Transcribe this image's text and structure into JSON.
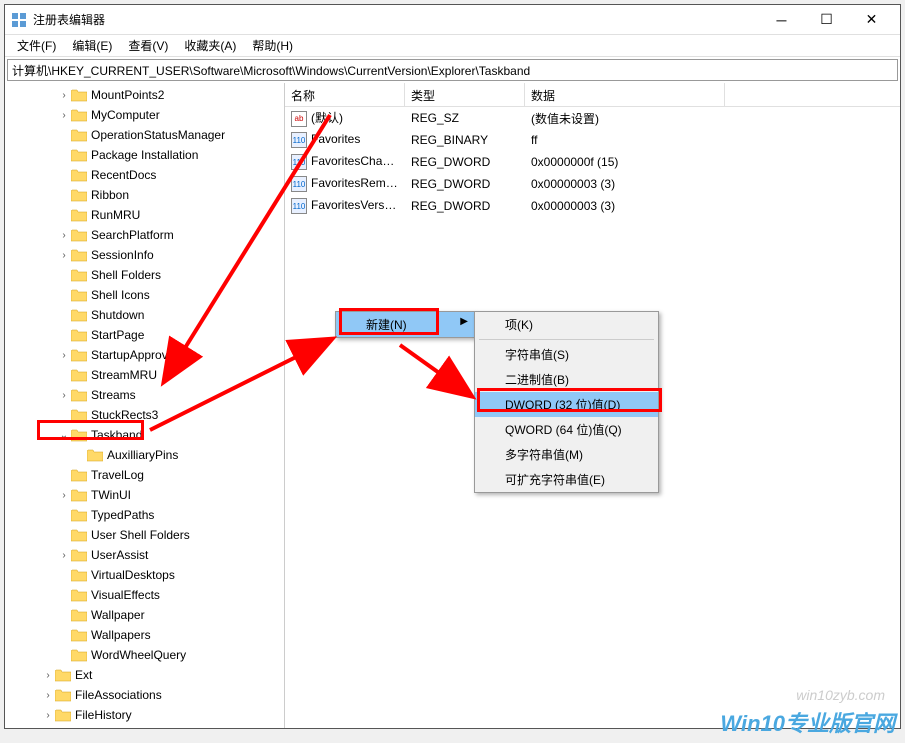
{
  "window": {
    "title": "注册表编辑器"
  },
  "menubar": {
    "file": "文件(F)",
    "edit": "编辑(E)",
    "view": "查看(V)",
    "favorites": "收藏夹(A)",
    "help": "帮助(H)"
  },
  "addressbar": "计算机\\HKEY_CURRENT_USER\\Software\\Microsoft\\Windows\\CurrentVersion\\Explorer\\Taskband",
  "tree": [
    {
      "indent": 3,
      "chev": ">",
      "label": "MountPoints2"
    },
    {
      "indent": 3,
      "chev": ">",
      "label": "MyComputer"
    },
    {
      "indent": 3,
      "chev": "",
      "label": "OperationStatusManager"
    },
    {
      "indent": 3,
      "chev": "",
      "label": "Package Installation"
    },
    {
      "indent": 3,
      "chev": "",
      "label": "RecentDocs"
    },
    {
      "indent": 3,
      "chev": "",
      "label": "Ribbon"
    },
    {
      "indent": 3,
      "chev": "",
      "label": "RunMRU"
    },
    {
      "indent": 3,
      "chev": ">",
      "label": "SearchPlatform"
    },
    {
      "indent": 3,
      "chev": ">",
      "label": "SessionInfo"
    },
    {
      "indent": 3,
      "chev": "",
      "label": "Shell Folders"
    },
    {
      "indent": 3,
      "chev": "",
      "label": "Shell Icons"
    },
    {
      "indent": 3,
      "chev": "",
      "label": "Shutdown"
    },
    {
      "indent": 3,
      "chev": "",
      "label": "StartPage"
    },
    {
      "indent": 3,
      "chev": ">",
      "label": "StartupApproved"
    },
    {
      "indent": 3,
      "chev": "",
      "label": "StreamMRU"
    },
    {
      "indent": 3,
      "chev": ">",
      "label": "Streams"
    },
    {
      "indent": 3,
      "chev": "",
      "label": "StuckRects3"
    },
    {
      "indent": 3,
      "chev": "v",
      "label": "Taskband",
      "highlight": true
    },
    {
      "indent": 4,
      "chev": "",
      "label": "AuxilliaryPins"
    },
    {
      "indent": 3,
      "chev": "",
      "label": "TravelLog"
    },
    {
      "indent": 3,
      "chev": ">",
      "label": "TWinUI"
    },
    {
      "indent": 3,
      "chev": "",
      "label": "TypedPaths"
    },
    {
      "indent": 3,
      "chev": "",
      "label": "User Shell Folders"
    },
    {
      "indent": 3,
      "chev": ">",
      "label": "UserAssist"
    },
    {
      "indent": 3,
      "chev": "",
      "label": "VirtualDesktops"
    },
    {
      "indent": 3,
      "chev": "",
      "label": "VisualEffects"
    },
    {
      "indent": 3,
      "chev": "",
      "label": "Wallpaper"
    },
    {
      "indent": 3,
      "chev": "",
      "label": "Wallpapers"
    },
    {
      "indent": 3,
      "chev": "",
      "label": "WordWheelQuery"
    },
    {
      "indent": 2,
      "chev": ">",
      "label": "Ext"
    },
    {
      "indent": 2,
      "chev": ">",
      "label": "FileAssociations"
    },
    {
      "indent": 2,
      "chev": ">",
      "label": "FileHistory"
    }
  ],
  "list_header": {
    "name": "名称",
    "type": "类型",
    "data": "数据"
  },
  "list_rows": [
    {
      "icon": "str",
      "name": "(默认)",
      "type": "REG_SZ",
      "data": "(数值未设置)"
    },
    {
      "icon": "bin",
      "name": "Favorites",
      "type": "REG_BINARY",
      "data": "ff"
    },
    {
      "icon": "bin",
      "name": "FavoritesChan...",
      "type": "REG_DWORD",
      "data": "0x0000000f (15)"
    },
    {
      "icon": "bin",
      "name": "FavoritesRemo...",
      "type": "REG_DWORD",
      "data": "0x00000003 (3)"
    },
    {
      "icon": "bin",
      "name": "FavoritesVersion",
      "type": "REG_DWORD",
      "data": "0x00000003 (3)"
    }
  ],
  "context_primary": {
    "new": "新建(N)"
  },
  "context_sub": {
    "key": "项(K)",
    "string": "字符串值(S)",
    "binary": "二进制值(B)",
    "dword": "DWORD (32 位)值(D)",
    "qword": "QWORD (64 位)值(Q)",
    "multi": "多字符串值(M)",
    "expand": "可扩充字符串值(E)"
  },
  "watermark1": "win10zyb.com",
  "watermark2": "Win10专业版官网"
}
